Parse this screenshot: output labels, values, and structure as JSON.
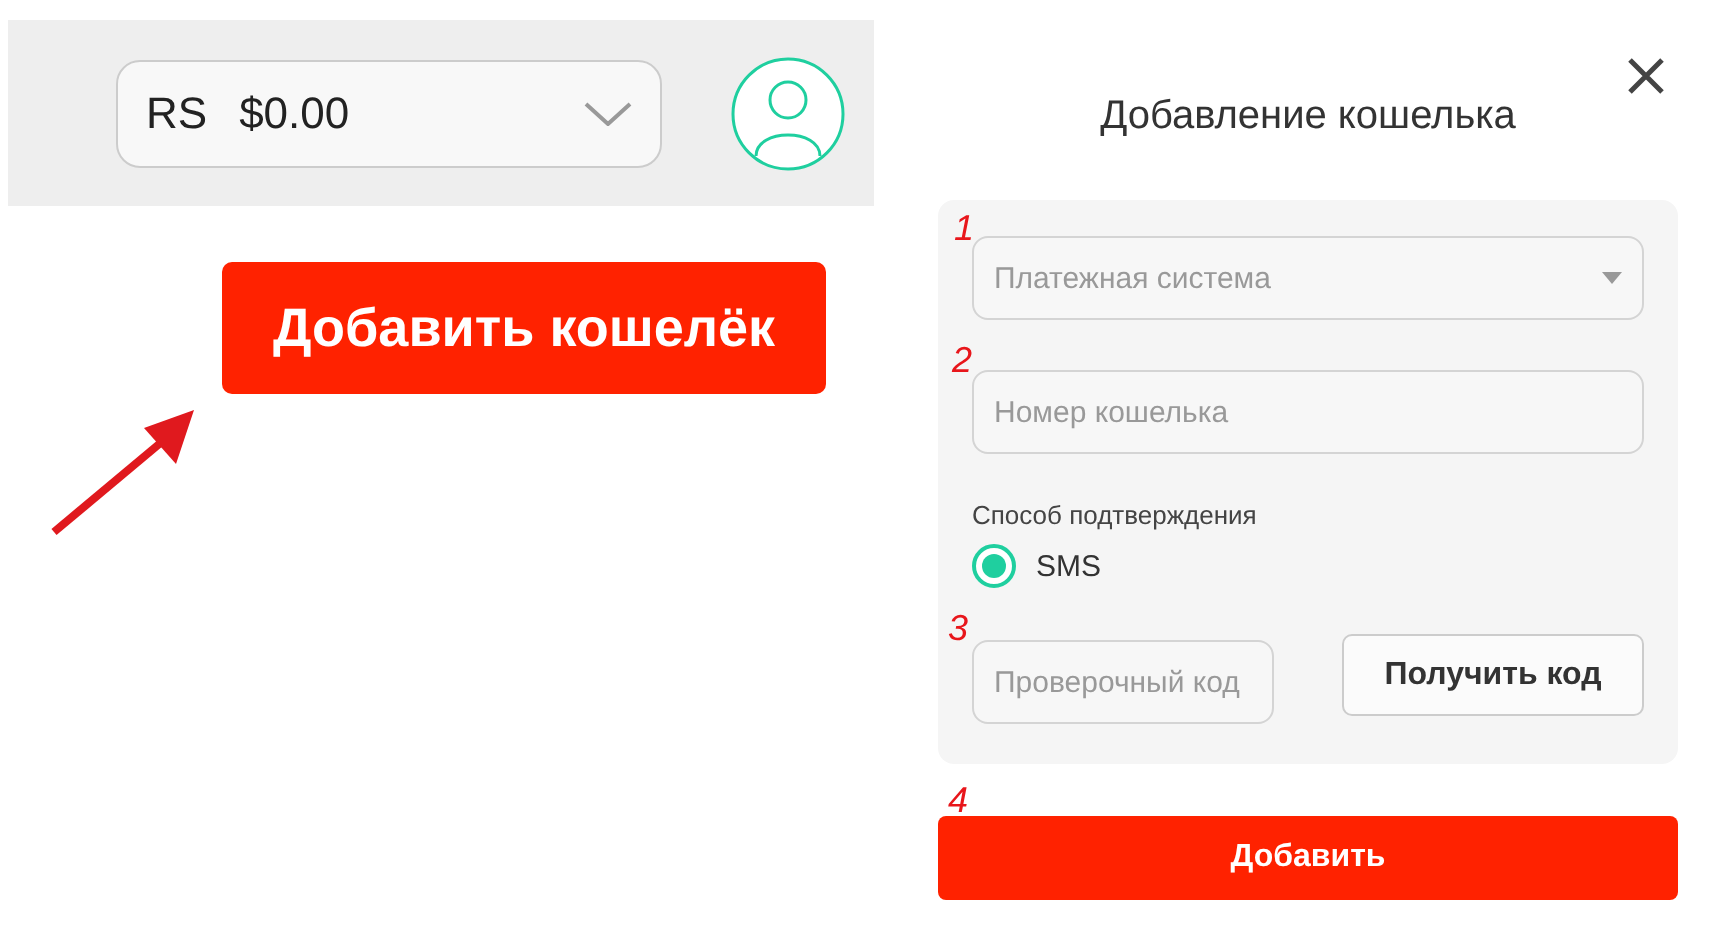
{
  "header": {
    "balance": {
      "currency": "RS",
      "amount": "$0.00"
    }
  },
  "add_wallet_button": "Добавить кошелёк",
  "dialog": {
    "title": "Добавление кошелька",
    "fields": [
      {
        "kind": "select",
        "placeholder": "Платежная система"
      },
      {
        "kind": "input",
        "placeholder": "Номер кошелька"
      }
    ],
    "confirmation": {
      "label": "Способ подтверждения",
      "options": [
        {
          "label": "SMS",
          "selected": true
        }
      ]
    },
    "code": {
      "placeholder": "Проверочный код",
      "button": "Получить код"
    },
    "submit": "Добавить"
  },
  "annotations": [
    "1",
    "2",
    "3",
    "4"
  ]
}
